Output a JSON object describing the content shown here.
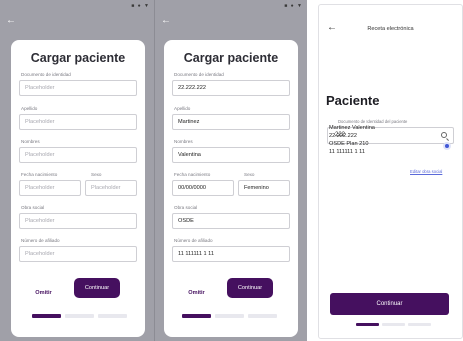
{
  "colors": {
    "accent": "#45105f",
    "overlay": "#a0a0a8",
    "radio": "#4258d6",
    "link": "#5b6ad9"
  },
  "screen1": {
    "status_icons": "■ ● ▼",
    "back_icon": "arrow-left-icon",
    "title": "Cargar paciente",
    "fields": {
      "documento": {
        "label": "Documento de identidad",
        "placeholder": "Placeholder"
      },
      "apellido": {
        "label": "Apellido",
        "placeholder": "Placeholder"
      },
      "nombres": {
        "label": "Nombres",
        "placeholder": "Placeholder"
      },
      "fecha": {
        "label": "Fecha nacimiento",
        "placeholder": "Placeholder"
      },
      "sexo": {
        "label": "Sexo",
        "placeholder": "Placeholder"
      },
      "obra": {
        "label": "Obra social",
        "placeholder": "Placeholder"
      },
      "afiliado": {
        "label": "Número de afiliado",
        "placeholder": "Placeholder"
      }
    },
    "omit_label": "Omitir",
    "continue_label": "Continuar",
    "steps_active": 1
  },
  "screen2": {
    "status_icons": "■ ● ▼",
    "back_icon": "arrow-left-icon",
    "title": "Cargar paciente",
    "fields": {
      "documento": {
        "label": "Documento de identidad",
        "value": "22.222.222"
      },
      "apellido": {
        "label": "Apellido",
        "value": "Martinez"
      },
      "nombres": {
        "label": "Nombres",
        "value": "Valentina"
      },
      "fecha": {
        "label": "Fecha nacimiento",
        "value": "00/00/0000"
      },
      "sexo": {
        "label": "Sexo",
        "value": "Femenino"
      },
      "obra": {
        "label": "Obra social",
        "value": "OSDE"
      },
      "afiliado": {
        "label": "Número de afiliado",
        "value": "11 111111 1 11"
      }
    },
    "omit_label": "Omitir",
    "continue_label": "Continuar",
    "steps_active": 1
  },
  "screen3": {
    "back_icon": "arrow-left-icon",
    "title": "Receta electrónica",
    "heading": "Paciente",
    "search_label": "Documento de Identidad del paciente",
    "search_value": "222",
    "result": {
      "name": "Martinez Valentina",
      "dni": "22.222.222",
      "plan": "OSDE Plan 210",
      "affiliate": "11 111111 1 11",
      "selected": true
    },
    "edit_link": "Editar obra social",
    "continue_label": "Continuar",
    "steps_active": 1
  }
}
